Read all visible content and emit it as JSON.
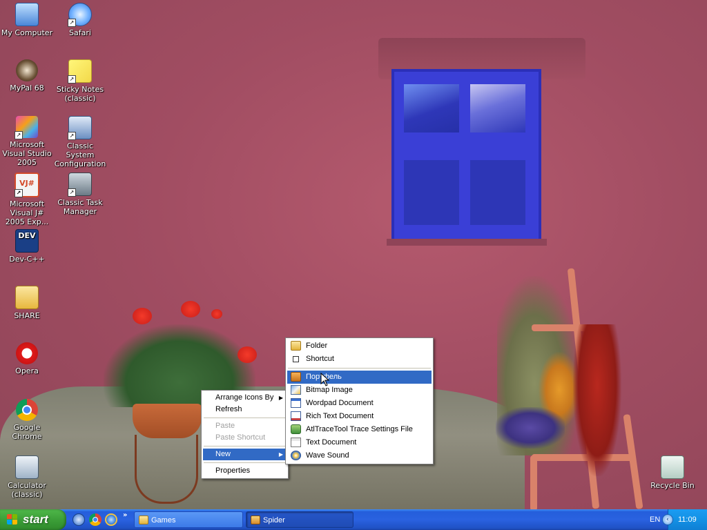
{
  "desktop": {
    "icons": [
      {
        "label": "My Computer",
        "icon": "my-computer-icon"
      },
      {
        "label": "Safari",
        "icon": "safari-icon"
      },
      {
        "label": "MyPal 68",
        "icon": "mypal-icon"
      },
      {
        "label": "Sticky Notes (classic)",
        "icon": "sticky-notes-icon"
      },
      {
        "label": "Microsoft Visual Studio 2005",
        "icon": "visual-studio-icon"
      },
      {
        "label": "Classic System Configuration",
        "icon": "system-configuration-icon"
      },
      {
        "label": "Microsoft Visual J# 2005 Exp...",
        "icon": "visual-jsharp-icon",
        "glyph_text": "VJ#"
      },
      {
        "label": "Classic Task Manager",
        "icon": "task-manager-icon"
      },
      {
        "label": "Dev-C++",
        "icon": "dev-cpp-icon",
        "glyph_text": "DEV"
      },
      {
        "label": "SHARE",
        "icon": "folder-icon"
      },
      {
        "label": "Opera",
        "icon": "opera-icon"
      },
      {
        "label": "Google Chrome",
        "icon": "chrome-icon"
      },
      {
        "label": "Calculator (classic)",
        "icon": "calculator-icon"
      },
      {
        "label": "Recycle Bin",
        "icon": "recycle-bin-icon"
      }
    ]
  },
  "context_menu": {
    "items": [
      {
        "label": "Arrange Icons By",
        "submenu": true
      },
      {
        "label": "Refresh"
      },
      {
        "label": "Paste",
        "disabled": true
      },
      {
        "label": "Paste Shortcut",
        "disabled": true
      },
      {
        "label": "New",
        "submenu": true,
        "selected": true
      },
      {
        "label": "Properties"
      }
    ]
  },
  "new_submenu": {
    "items": [
      {
        "label": "Folder",
        "icon": "folder-icon"
      },
      {
        "label": "Shortcut",
        "icon": "shortcut-icon"
      },
      {
        "label": "Портфель",
        "icon": "briefcase-icon",
        "selected": true
      },
      {
        "label": "Bitmap Image",
        "icon": "bitmap-icon"
      },
      {
        "label": "Wordpad Document",
        "icon": "wordpad-icon"
      },
      {
        "label": "Rich Text Document",
        "icon": "rich-text-icon"
      },
      {
        "label": "AtlTraceTool Trace Settings File",
        "icon": "atltrace-icon"
      },
      {
        "label": "Text Document",
        "icon": "text-document-icon"
      },
      {
        "label": "Wave Sound",
        "icon": "wave-sound-icon"
      }
    ]
  },
  "taskbar": {
    "start_label": "start",
    "more_label": "»",
    "tasks": [
      {
        "label": "Games",
        "icon": "folder-icon",
        "active": false
      },
      {
        "label": "Spider",
        "icon": "spider-solitaire-icon",
        "active": true
      }
    ],
    "language": "EN",
    "clock": "11:09",
    "tray_chevron": "‹"
  },
  "colors": {
    "taskbar_blue": "#245edb",
    "start_green": "#3c9f38",
    "menu_highlight": "#316ac5",
    "wall": "#a04f63",
    "window_blue": "#3a3fd6"
  }
}
